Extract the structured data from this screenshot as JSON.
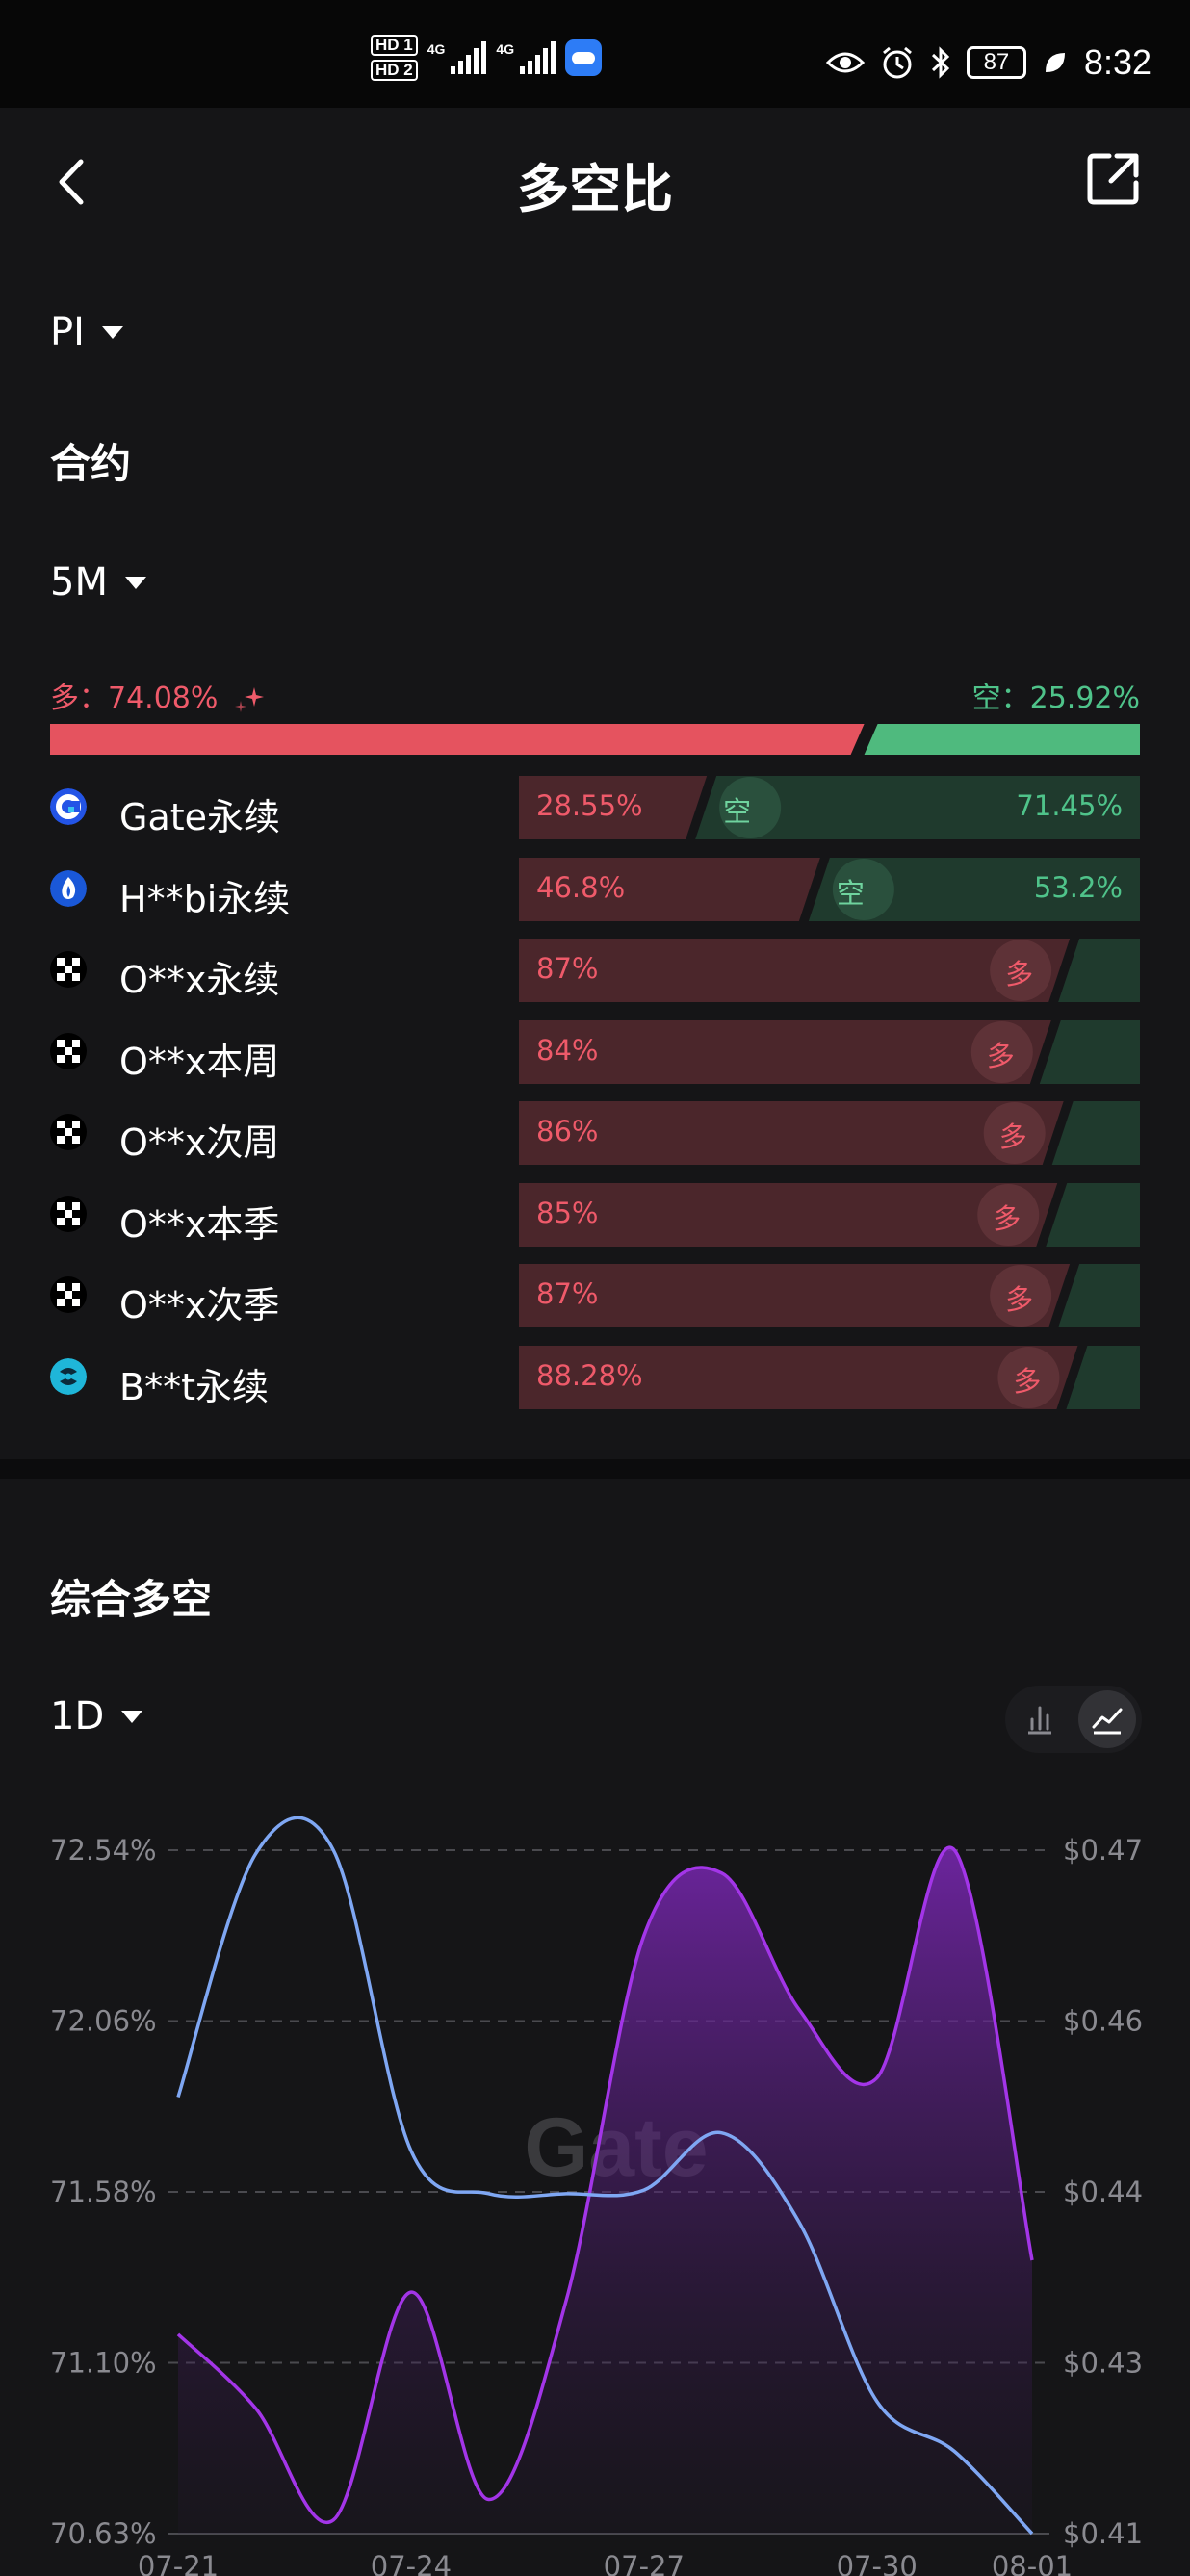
{
  "status_bar": {
    "network": "4G",
    "battery": "87",
    "time": "8:32",
    "sim1": "HD 1",
    "sim2": "HD 2"
  },
  "header": {
    "title": "多空比"
  },
  "coin_selector": {
    "value": "PI"
  },
  "contract_section": {
    "title": "合约",
    "period": "5M"
  },
  "ratio": {
    "long_label": "多：74.08%",
    "short_label": "空：25.92%",
    "long_pct": 74.08,
    "long_color": "#e5535f",
    "short_color": "#4fba7e"
  },
  "exchanges": [
    {
      "name": "Gate永续",
      "long": "28.55%",
      "short": "71.45%",
      "long_pct": 28.55,
      "dominant": "short",
      "tag": "空",
      "logo": "gate-logo"
    },
    {
      "name": "H**bi永续",
      "long": "46.8%",
      "short": "53.2%",
      "long_pct": 46.8,
      "dominant": "short",
      "tag": "空",
      "logo": "huobi-logo"
    },
    {
      "name": "O**x永续",
      "long": "87%",
      "short": "",
      "long_pct": 87,
      "dominant": "long",
      "tag": "多",
      "logo": "okx-logo"
    },
    {
      "name": "O**x本周",
      "long": "84%",
      "short": "",
      "long_pct": 84,
      "dominant": "long",
      "tag": "多",
      "logo": "okx-logo"
    },
    {
      "name": "O**x次周",
      "long": "86%",
      "short": "",
      "long_pct": 86,
      "dominant": "long",
      "tag": "多",
      "logo": "okx-logo"
    },
    {
      "name": "O**x本季",
      "long": "85%",
      "short": "",
      "long_pct": 85,
      "dominant": "long",
      "tag": "多",
      "logo": "okx-logo"
    },
    {
      "name": "O**x次季",
      "long": "87%",
      "short": "",
      "long_pct": 87,
      "dominant": "long",
      "tag": "多",
      "logo": "okx-logo"
    },
    {
      "name": "B**t永续",
      "long": "88.28%",
      "short": "",
      "long_pct": 88.28,
      "dominant": "long",
      "tag": "多",
      "logo": "bybit-logo"
    }
  ],
  "composite_section": {
    "title": "综合多空",
    "period": "1D",
    "toggle": [
      "bar-chart-icon",
      "line-chart-icon"
    ],
    "active_toggle": "line-chart-icon"
  },
  "chart_data": {
    "type": "line",
    "watermark": "Gate",
    "x": [
      "07-21",
      "07-22",
      "07-23",
      "07-24",
      "07-25",
      "07-26",
      "07-27",
      "07-28",
      "07-29",
      "07-30",
      "07-31",
      "08-01"
    ],
    "x_tick_labels": [
      "07-21",
      "07-24",
      "07-27",
      "07-30",
      "08-01"
    ],
    "y_left_ticks": [
      "72.54%",
      "72.06%",
      "71.58%",
      "71.10%",
      "70.63%"
    ],
    "y_left_range": [
      70.63,
      72.54
    ],
    "y_right_ticks": [
      "$0.47",
      "$0.46",
      "$0.44",
      "$0.43",
      "$0.41"
    ],
    "y_right_range": [
      0.41,
      0.47
    ],
    "series": [
      {
        "color": "#7fa7f3",
        "axis": "left",
        "values": [
          71.85,
          72.53,
          72.54,
          71.7,
          71.58,
          71.58,
          71.59,
          71.75,
          71.5,
          71.0,
          70.86,
          70.63
        ]
      },
      {
        "color": "#a335e8",
        "axis": "right",
        "fill": true,
        "values": [
          0.4275,
          0.421,
          0.4112,
          0.4312,
          0.413,
          0.4305,
          0.4625,
          0.468,
          0.456,
          0.45,
          0.47,
          0.434
        ]
      }
    ],
    "grid": true
  }
}
